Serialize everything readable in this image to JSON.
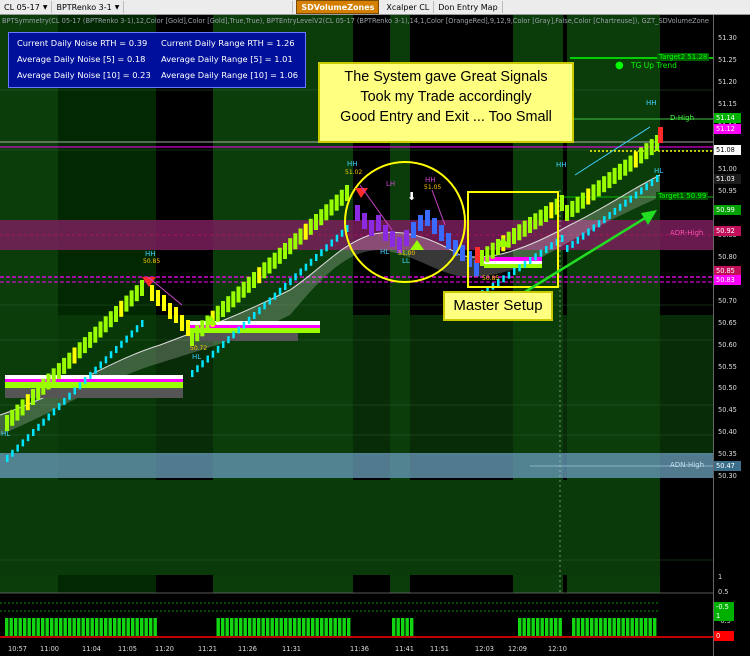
{
  "toolbar": {
    "instrument": "CL 05-17",
    "bar_type": "BPTRenko 3-1",
    "indicator_button": "SDVolumeZones",
    "xcalper": "Xcalper CL",
    "don_entry": "Don Entry Map"
  },
  "indicator_line": "BPTSymmetry(CL 05-17 (BPTRenko 3-1),12,Color [Gold],Color [Gold],True,True), BPTEntryLevelV2(CL 05-17 (BPTRenko 3-1),14,1,Color [OrangeRed],9,12,9,Color [Gray],False,Color [Chartreuse]), GZT_SDVolumeZone",
  "stats": {
    "noise_rth": "Current Daily Noise RTH = 0.39",
    "avg_noise_5": "Average Daily Noise [5] = 0.18",
    "avg_noise_10": "Average Daily Noise [10] = 0.23",
    "range_rth": "Current Daily Range RTH = 1.26",
    "avg_range_5": "Average Daily Range [5] = 1.01",
    "avg_range_10": "Average Daily Range [10] = 1.06"
  },
  "callout": {
    "line1": "The System gave Great Signals",
    "line2": "Took my Trade accordingly",
    "line3": "Good Entry and Exit ... Too Small"
  },
  "master_setup": "Master Setup",
  "price_axis": [
    "51.30",
    "51.25",
    "51.20",
    "51.15",
    "51.10",
    "51.05",
    "51.00",
    "50.95",
    "50.90",
    "50.85",
    "50.80",
    "50.75",
    "50.70",
    "50.65",
    "50.60",
    "50.55",
    "50.50",
    "50.45",
    "50.40",
    "50.35",
    "50.30"
  ],
  "price_badges": [
    {
      "text": "51.14",
      "bg": "#00b000",
      "fg": "#ffffff"
    },
    {
      "text": "51.12",
      "bg": "#ff00ff",
      "fg": "#ffffff"
    },
    {
      "text": "51.08",
      "bg": "#ffffff",
      "fg": "#000000"
    },
    {
      "text": "51.03",
      "bg": "#1c1c1c",
      "fg": "#ffffff"
    },
    {
      "text": "50.99",
      "bg": "#00a000",
      "fg": "#ffffff"
    },
    {
      "text": "50.92",
      "bg": "#c0105a",
      "fg": "#ffffff"
    },
    {
      "text": "50.85",
      "bg": "#c0105a",
      "fg": "#ffffff"
    },
    {
      "text": "50.83",
      "bg": "#ff00ff",
      "fg": "#ffffff"
    },
    {
      "text": "50.47",
      "bg": "#3a6e8a",
      "fg": "#ffffff"
    }
  ],
  "osc_axis": [
    "1",
    "0.5",
    "0",
    "-0.5",
    "-1"
  ],
  "osc_badges": [
    {
      "text": "-0.5",
      "bg": "#00b000",
      "fg": "#ffffff"
    },
    {
      "text": "1",
      "bg": "#00b000",
      "fg": "#ffffff"
    },
    {
      "text": "0",
      "bg": "#ff0000",
      "fg": "#ffffff"
    }
  ],
  "time_axis": [
    "10:57",
    "11:00",
    "11:04",
    "11:05",
    "11:20",
    "11:21",
    "11:26",
    "11:31",
    "11:36",
    "11:41",
    "11:51",
    "12:03",
    "12:09",
    "12:10"
  ],
  "labels": {
    "target2": "Target2 51.28",
    "tg_up": "TG Up Trend",
    "d_high": "D-High",
    "adr_high": "ADR-High",
    "target1": "Target1 50.99",
    "adn_high": "ADN-High",
    "hh": "HH",
    "hl": "HL",
    "lh": "LH",
    "ll": "LL",
    "p5085": "50.85",
    "p5072": "50.72",
    "p5102": "51.02",
    "p5100": "51.00",
    "p5090": "50.90",
    "p5085b": "50.85",
    "p5105": "51.05"
  },
  "colors": {
    "zone_green": "#0b3d0b",
    "zone_bright": "#00b000",
    "renko_lime": "#99ff00",
    "renko_yellow": "#ffff00",
    "renko_cyan": "#00e5ff",
    "adr_band": "#7a1f5c",
    "adn_band": "#5f8fa8"
  }
}
